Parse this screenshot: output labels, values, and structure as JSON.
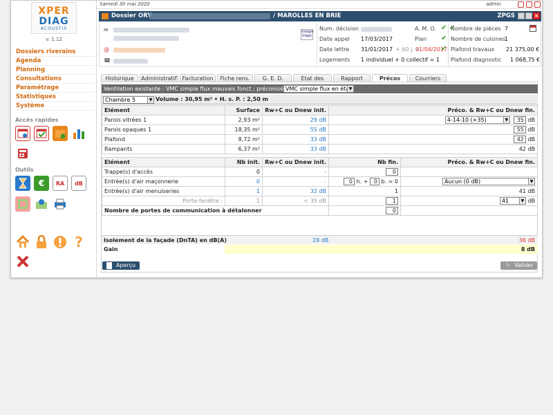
{
  "app": {
    "logo_top": "XPER",
    "logo_mid": "DIAG",
    "logo_sub": "ACOUSTIS",
    "version": "v. 1.12"
  },
  "topbar": {
    "date": "Samedi 30 mai 2020",
    "user": "admin"
  },
  "sidebar": {
    "menu": [
      "Dossiers riverains",
      "Agenda",
      "Planning",
      "Consultations",
      "Paramétrage",
      "Statistiques",
      "Système"
    ],
    "quick_title": "Accès rapides",
    "tools_title": "Outils"
  },
  "titlebar": {
    "prefix": "Dossier ORY-",
    "suffix": "/ MAROLLES EN BRIE",
    "code": "ZPGS"
  },
  "info": {
    "gmaps_label": "Google maps",
    "labels": {
      "decision": "Num. décision",
      "appel": "Date appel",
      "lettre": "Date lettre",
      "logements": "Logements",
      "amo": "A. M. O.",
      "plan": "Plan",
      "pieces": "Nombre de pièces",
      "cuisines": "Nombre de cuisines",
      "travaux": "Plafond travaux",
      "diagnostic": "Plafond diagnostic"
    },
    "values": {
      "appel": "17/03/2017",
      "lettre": "31/01/2017",
      "lettre_plus": "+ 60 j. =",
      "lettre_due": "01/04/2017",
      "logements": "1 individuel + 0 collectif = 1",
      "pieces": "7",
      "cuisines": "1",
      "travaux": "21 375,00 €",
      "diagnostic": "1 068,75 €"
    }
  },
  "tabs": [
    {
      "label": "Historique",
      "active": false
    },
    {
      "label": "Administratif",
      "active": false
    },
    {
      "label": "Facturation",
      "active": false
    },
    {
      "label": "Fiche rens.",
      "active": false
    },
    {
      "label": "G. E. D.",
      "active": false
    },
    {
      "label": "Etat des lieux",
      "active": false
    },
    {
      "label": "Rapport",
      "active": false
    },
    {
      "label": "Précos",
      "active": true
    },
    {
      "label": "Courriers",
      "active": false
    }
  ],
  "precos": {
    "ventilation_text": "Ventilation existante : VMC simple flux mauvais fonct.; préconisée :",
    "ventilation_value": "VMC simple flux en état",
    "room_value": "Chambre 5",
    "room_info": "Volume : 30,95 m³ • H. s. P. : 2,50 m",
    "t1_headers": [
      "Elément",
      "Surface",
      "Rw+C ou Dnew init.",
      "Préco. & Rw+C ou Dnew fin."
    ],
    "t1_rows": [
      {
        "name": "Parois vitrées 1",
        "surface": "2,93 m²",
        "init": "29 dB",
        "preco": "4-14-10 (+35)",
        "fin": "35",
        "unit": "dB"
      },
      {
        "name": "Parois opaques 1",
        "surface": "18,35 m²",
        "init": "55 dB",
        "fin": "55",
        "unit": "dB"
      },
      {
        "name": "Plafond",
        "surface": "8,72 m²",
        "init": "33 dB",
        "fin": "42",
        "unit": "dB"
      },
      {
        "name": "Rampants",
        "surface": "6,37 m²",
        "init": "33 dB",
        "fin": "42 dB"
      }
    ],
    "t2_headers": [
      "Elément",
      "Nb init.",
      "Rw+C ou Dnew init.",
      "Nb fin.",
      "Préco. & Rw+C ou Dnew fin."
    ],
    "t2_rows": [
      {
        "name": "Trappe(s) d'accès",
        "nb": "0",
        "init": "-",
        "fin": "0"
      },
      {
        "name": "Entrée(s) d'air maçonnerie",
        "nb": "0",
        "init": "-",
        "h": "0",
        "hl": "h. +",
        "b": "0",
        "bl": "b. = 0",
        "preco": "Aucun (0 dB)"
      },
      {
        "name": "Entrée(s) d'air menuiseries",
        "nb": "1",
        "init": "32 dB",
        "fin": "1",
        "result": "41 dB"
      },
      {
        "name": "Porte-fenêtre :",
        "nb": "1",
        "init": "< 35 dB",
        "fin": "1",
        "preco": "41",
        "unit": "dB"
      }
    ],
    "portes_label": "Nombre de portes de communication à détalonner",
    "portes_value": "0",
    "isolement_label": "Isolement de la façade (DnTA) en dB(A)",
    "isolement_init": "28 dB",
    "isolement_fin": "36 dB",
    "gain_label": "Gain",
    "gain_value": "8 dB"
  },
  "buttons": {
    "apercu": "Aperçu",
    "valider": "Valider"
  },
  "colors": {
    "accent": "#e8861c",
    "navy": "#2d4f6e",
    "blue": "#2a79c8",
    "red": "#d33333",
    "yellow": "#ffffcc"
  }
}
